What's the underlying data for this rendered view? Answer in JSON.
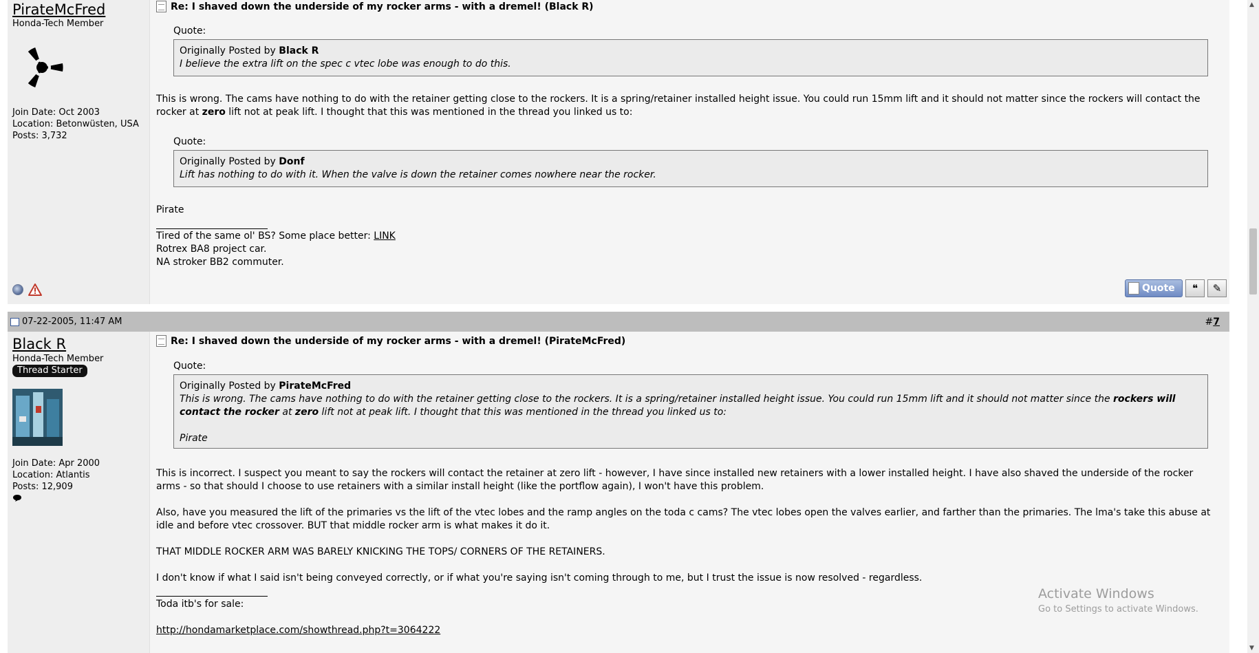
{
  "post1": {
    "username": "PirateMcFred",
    "user_title": "Honda-Tech Member",
    "join_date": "Join Date: Oct 2003",
    "location": "Location: Betonwüsten, USA",
    "posts": "Posts: 3,732",
    "title": "Re: I shaved down the underside of my rocker arms - with a dremel! (Black R)",
    "quote1": {
      "label": "Quote:",
      "prefix": "Originally Posted by ",
      "author": "Black R",
      "text": "I believe the extra lift on the spec c vtec lobe was enough to do this."
    },
    "body_part1": "This is wrong. The cams have nothing to do with the retainer getting close to the rockers. It is a spring/retainer installed height issue. You could run 15mm lift and it should not matter since the rockers will contact the rocker at ",
    "body_bold": "zero",
    "body_part2": " lift not at peak lift. I thought that this was mentioned in the thread you linked us to:",
    "quote2": {
      "label": "Quote:",
      "prefix": "Originally Posted by ",
      "author": "Donf",
      "text": "Lift has nothing to do with it. When the valve is down the retainer comes nowhere near the rocker."
    },
    "signoff": "Pirate",
    "sig_line1_text": "Tired of the same ol' BS? Some place better: ",
    "sig_link": "LINK",
    "sig_line2": "Rotrex BA8 project car.",
    "sig_line3": "NA stroker BB2 commuter.",
    "quote_button": "Quote"
  },
  "post2_header": {
    "date": "07-22-2005, 11:47 AM",
    "post_number_prefix": "#",
    "post_number": "7"
  },
  "post2": {
    "username": "Black R",
    "user_title": "Honda-Tech Member",
    "badge": "Thread Starter",
    "join_date": "Join Date: Apr 2000",
    "location": "Location: Atlantis",
    "posts": "Posts: 12,909",
    "title": "Re: I shaved down the underside of my rocker arms - with a dremel! (PirateMcFred)",
    "quote": {
      "label": "Quote:",
      "prefix": "Originally Posted by ",
      "author": "PirateMcFred",
      "text_a": "This is wrong. The cams have nothing to do with the retainer getting close to the rockers. It is a spring/retainer installed height issue. You could run 15mm lift and it should not matter since the ",
      "text_bold1": "rockers will contact the rocker",
      "text_b": " at ",
      "text_bold2": "zero",
      "text_c": " lift not at peak lift. I thought that this was mentioned in the thread you linked us to:",
      "signoff": "Pirate"
    },
    "para1": "This is incorrect. I suspect you meant to say the rockers will contact the retainer at zero lift - however, I have since installed new retainers with a lower installed height. I have also shaved the underside of the rocker arms - so that should I choose to use retainers with a similar install height (like the portflow again), I won't have this problem.",
    "para2": "Also, have you measured the lift of the primaries vs the lift of the vtec lobes and the ramp angles on the toda c cams? The vtec lobes open the valves earlier, and farther than the primaries. The lma's take this abuse at idle and before vtec crossover. BUT that middle rocker arm is what makes it do it.",
    "para3": "THAT MIDDLE ROCKER ARM WAS BARELY KNICKING THE TOPS/ CORNERS OF THE RETAINERS.",
    "para4": "I don't know if what I said isn't being conveyed correctly, or if what you're saying isn't coming through to me, but I trust the issue is now resolved - regardless.",
    "sig_line1": "Toda itb's for sale:",
    "sig_link": "http://hondamarketplace.com/showthread.php?t=3064222"
  },
  "watermark": {
    "title": "Activate Windows",
    "subtitle": "Go to Settings to activate Windows."
  },
  "icons": {
    "online": "online-status-icon",
    "report": "report-warning-icon",
    "multiquote": "multiquote-icon",
    "edit": "edit-post-icon",
    "post_doc": "post-document-icon",
    "new_post": "new-post-icon",
    "pm": "private-message-icon"
  }
}
